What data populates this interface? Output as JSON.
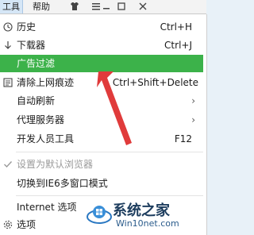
{
  "topbar": {
    "tools_label": "工具",
    "help_label": "帮助"
  },
  "menu": {
    "items": [
      {
        "label": "历史",
        "shortcut": "Ctrl+H"
      },
      {
        "label": "下载器",
        "shortcut": "Ctrl+J"
      },
      {
        "label": "广告过滤"
      },
      {
        "label": "清除上网痕迹",
        "shortcut": "Ctrl+Shift+Delete"
      },
      {
        "label": "自动刷新"
      },
      {
        "label": "代理服务器"
      },
      {
        "label": "开发人员工具",
        "shortcut": "F12"
      },
      {
        "label": "设置为默认浏览器"
      },
      {
        "label": "切换到IE6多窗口模式"
      },
      {
        "label": "Internet 选项"
      },
      {
        "label": "选项"
      }
    ]
  },
  "watermark": {
    "title": "系统之家",
    "url": "Win10net.com"
  },
  "colors": {
    "highlight": "#3cb24a",
    "arrow": "#e03b3b"
  }
}
